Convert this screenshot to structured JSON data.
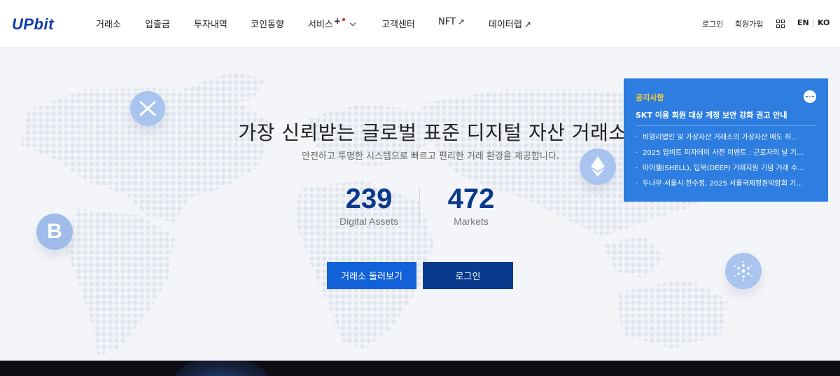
{
  "header": {
    "logo": "UPbit",
    "nav": [
      {
        "label": "거래소"
      },
      {
        "label": "입출금"
      },
      {
        "label": "투자내역"
      },
      {
        "label": "코인동향"
      },
      {
        "label": "서비스",
        "sup": "+"
      },
      {
        "label": "고객센터"
      },
      {
        "label": "NFT",
        "ext": "↗"
      },
      {
        "label": "데이터랩",
        "ext": "↗"
      }
    ],
    "login": "로그인",
    "signup": "회원가입",
    "lang_en": "EN",
    "lang_ko": "KO"
  },
  "hero": {
    "title": "가장 신뢰받는 글로벌 표준 디지털 자산 거래소",
    "subtitle": "안전하고 투명한 시스템으로 빠르고 편리한 거래 환경을 제공합니다.",
    "stats": [
      {
        "value": "239",
        "label": "Digital Assets"
      },
      {
        "value": "472",
        "label": "Markets"
      }
    ],
    "primary_button": "거래소 둘러보기",
    "secondary_button": "로그인"
  },
  "notice": {
    "label": "공지사항",
    "headline": "SKT 이용 회원 대상 계정 보안 강화 권고 안내",
    "items": [
      "비영리법인 및 가상자산 거래소의 가상자산 매도 허…",
      "2025 업비트 피자데이 사전 이벤트 : 근로자의 날 기…",
      "마이쉘(SHELL), 딥북(DEEP) 거래지원 기념 거래 수…",
      "두나무·서울시·한수정, 2025 서울국제정원박람회 기…"
    ]
  },
  "colors": {
    "brand": "#0a3ca8",
    "primary_button": "#1261d8",
    "secondary_button": "#0a3a8e",
    "notice_bg": "#2e7de0",
    "notice_label": "#ffcf33",
    "coin": "#a9c4ef"
  },
  "icons": {
    "menu": "grid-icon",
    "notice_more": "more-icon",
    "coins": [
      "xrp-icon",
      "ethereum-icon",
      "bitcoin-icon",
      "cardano-icon"
    ]
  }
}
